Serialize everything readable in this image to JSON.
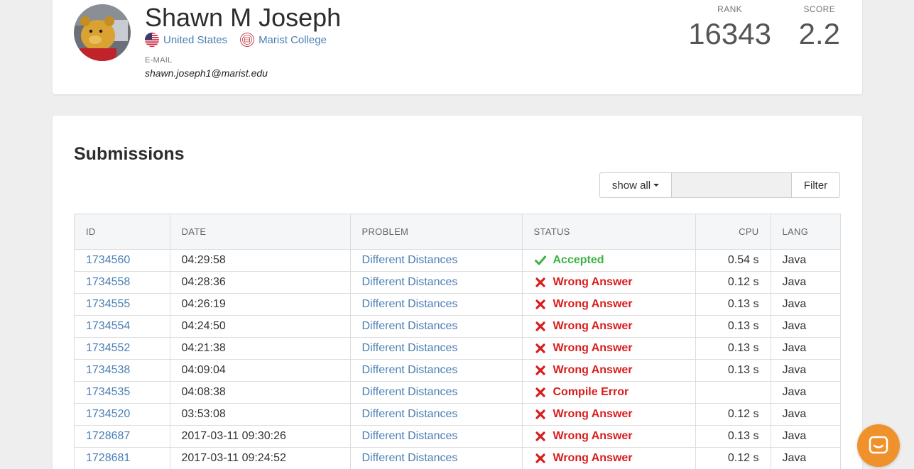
{
  "profile": {
    "name": "Shawn M Joseph",
    "country": "United States",
    "school": "Marist College",
    "email_label": "E-MAIL",
    "email": "shawn.joseph1@marist.edu",
    "rank_label": "RANK",
    "rank": "16343",
    "score_label": "SCORE",
    "score": "2.2"
  },
  "submissions": {
    "title": "Submissions",
    "filter": {
      "dropdown_label": "show all",
      "input_value": "",
      "button_label": "Filter"
    },
    "columns": [
      "ID",
      "DATE",
      "PROBLEM",
      "STATUS",
      "CPU",
      "LANG"
    ],
    "rows": [
      {
        "id": "1734560",
        "date": "04:29:58",
        "problem": "Different Distances",
        "status": "Accepted",
        "cpu": "0.54 s",
        "lang": "Java"
      },
      {
        "id": "1734558",
        "date": "04:28:36",
        "problem": "Different Distances",
        "status": "Wrong Answer",
        "cpu": "0.12 s",
        "lang": "Java"
      },
      {
        "id": "1734555",
        "date": "04:26:19",
        "problem": "Different Distances",
        "status": "Wrong Answer",
        "cpu": "0.13 s",
        "lang": "Java"
      },
      {
        "id": "1734554",
        "date": "04:24:50",
        "problem": "Different Distances",
        "status": "Wrong Answer",
        "cpu": "0.13 s",
        "lang": "Java"
      },
      {
        "id": "1734552",
        "date": "04:21:38",
        "problem": "Different Distances",
        "status": "Wrong Answer",
        "cpu": "0.13 s",
        "lang": "Java"
      },
      {
        "id": "1734538",
        "date": "04:09:04",
        "problem": "Different Distances",
        "status": "Wrong Answer",
        "cpu": "0.13 s",
        "lang": "Java"
      },
      {
        "id": "1734535",
        "date": "04:08:38",
        "problem": "Different Distances",
        "status": "Compile Error",
        "cpu": "",
        "lang": "Java"
      },
      {
        "id": "1734520",
        "date": "03:53:08",
        "problem": "Different Distances",
        "status": "Wrong Answer",
        "cpu": "0.12 s",
        "lang": "Java"
      },
      {
        "id": "1728687",
        "date": "2017-03-11 09:30:26",
        "problem": "Different Distances",
        "status": "Wrong Answer",
        "cpu": "0.13 s",
        "lang": "Java"
      },
      {
        "id": "1728681",
        "date": "2017-03-11 09:24:52",
        "problem": "Different Distances",
        "status": "Wrong Answer",
        "cpu": "0.12 s",
        "lang": "Java"
      }
    ]
  },
  "icons": {
    "country_flag": "us-flag-icon",
    "school_logo": "school-seal-icon",
    "accepted": "check-icon",
    "rejected": "cross-icon",
    "chat": "chat-icon"
  },
  "colors": {
    "link": "#4a7fb5",
    "accepted": "#3bb243",
    "error": "#d81d1d",
    "chat_bubble": "#f0922b"
  }
}
